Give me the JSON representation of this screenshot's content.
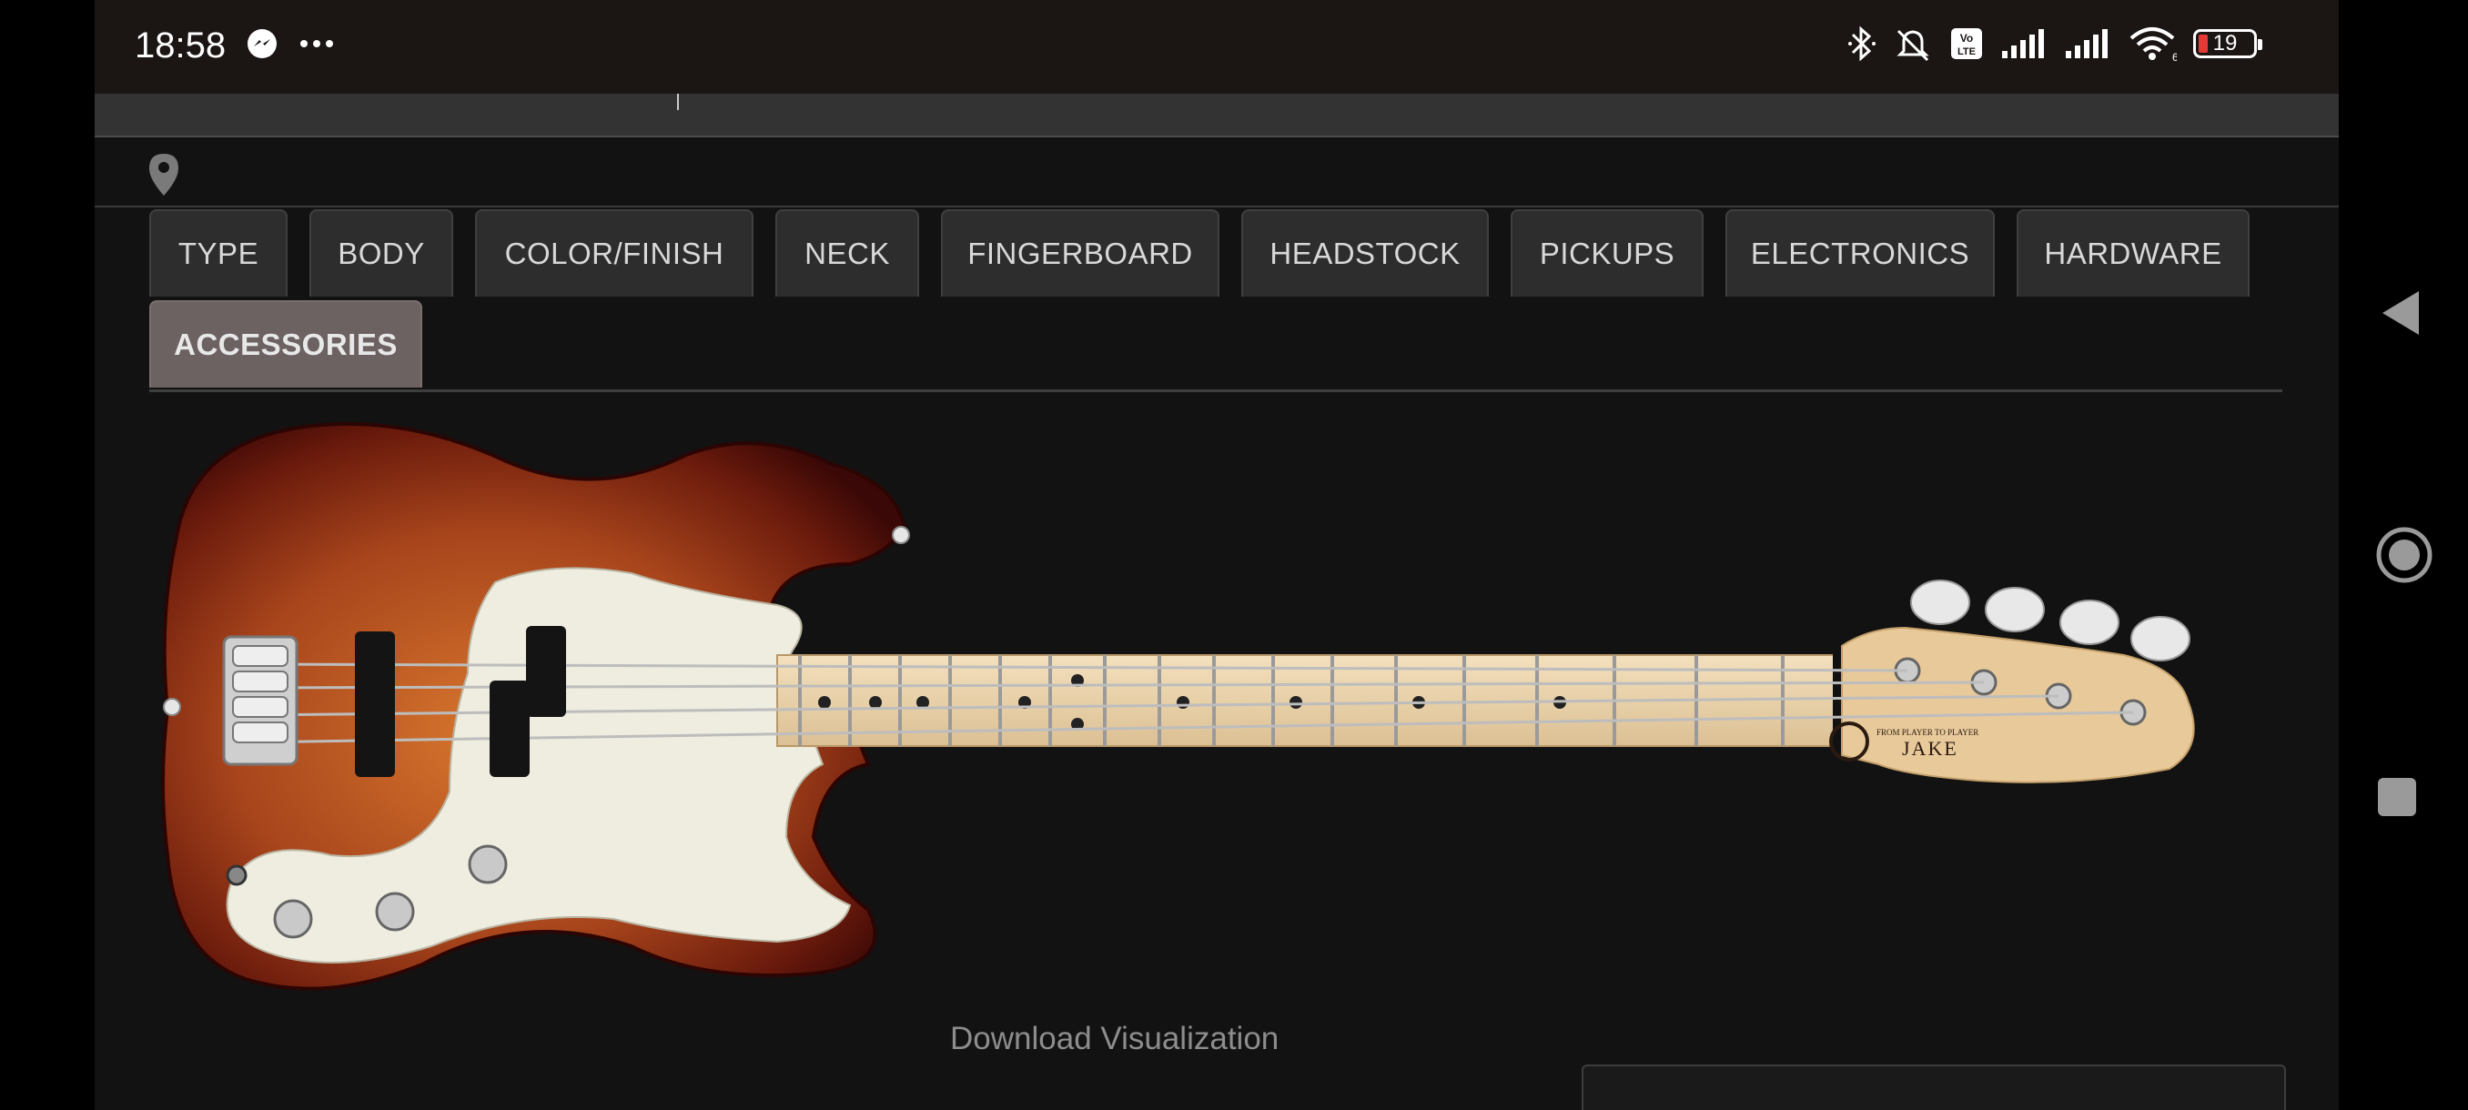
{
  "status_bar": {
    "time": "18:58",
    "icons_left": [
      "messenger-icon",
      "more-dots-icon"
    ],
    "icons_right": [
      "bluetooth-icon",
      "mute-icon",
      "volte-icon",
      "signal-icon",
      "signal-icon",
      "wifi-icon"
    ],
    "wifi_badge": "6",
    "battery": "19",
    "battery_color": "#e53935"
  },
  "tabs": [
    {
      "label": "TYPE",
      "active": false
    },
    {
      "label": "BODY",
      "active": false
    },
    {
      "label": "COLOR/FINISH",
      "active": false
    },
    {
      "label": "NECK",
      "active": false
    },
    {
      "label": "FINGERBOARD",
      "active": false
    },
    {
      "label": "HEADSTOCK",
      "active": false
    },
    {
      "label": "PICKUPS",
      "active": false
    },
    {
      "label": "ELECTRONICS",
      "active": false
    },
    {
      "label": "HARDWARE",
      "active": false
    },
    {
      "label": "ACCESSORIES",
      "active": true
    }
  ],
  "guitar": {
    "headstock_brand": "JAKE",
    "headstock_tagline": "FROM PLAYER TO PLAYER",
    "body_finish_color": "#a8451c",
    "pickguard_color": "#efece0",
    "neck_color": "#ead4b0"
  },
  "download_label": "Download Visualization",
  "nav": [
    "back-icon",
    "home-icon",
    "recents-icon"
  ]
}
